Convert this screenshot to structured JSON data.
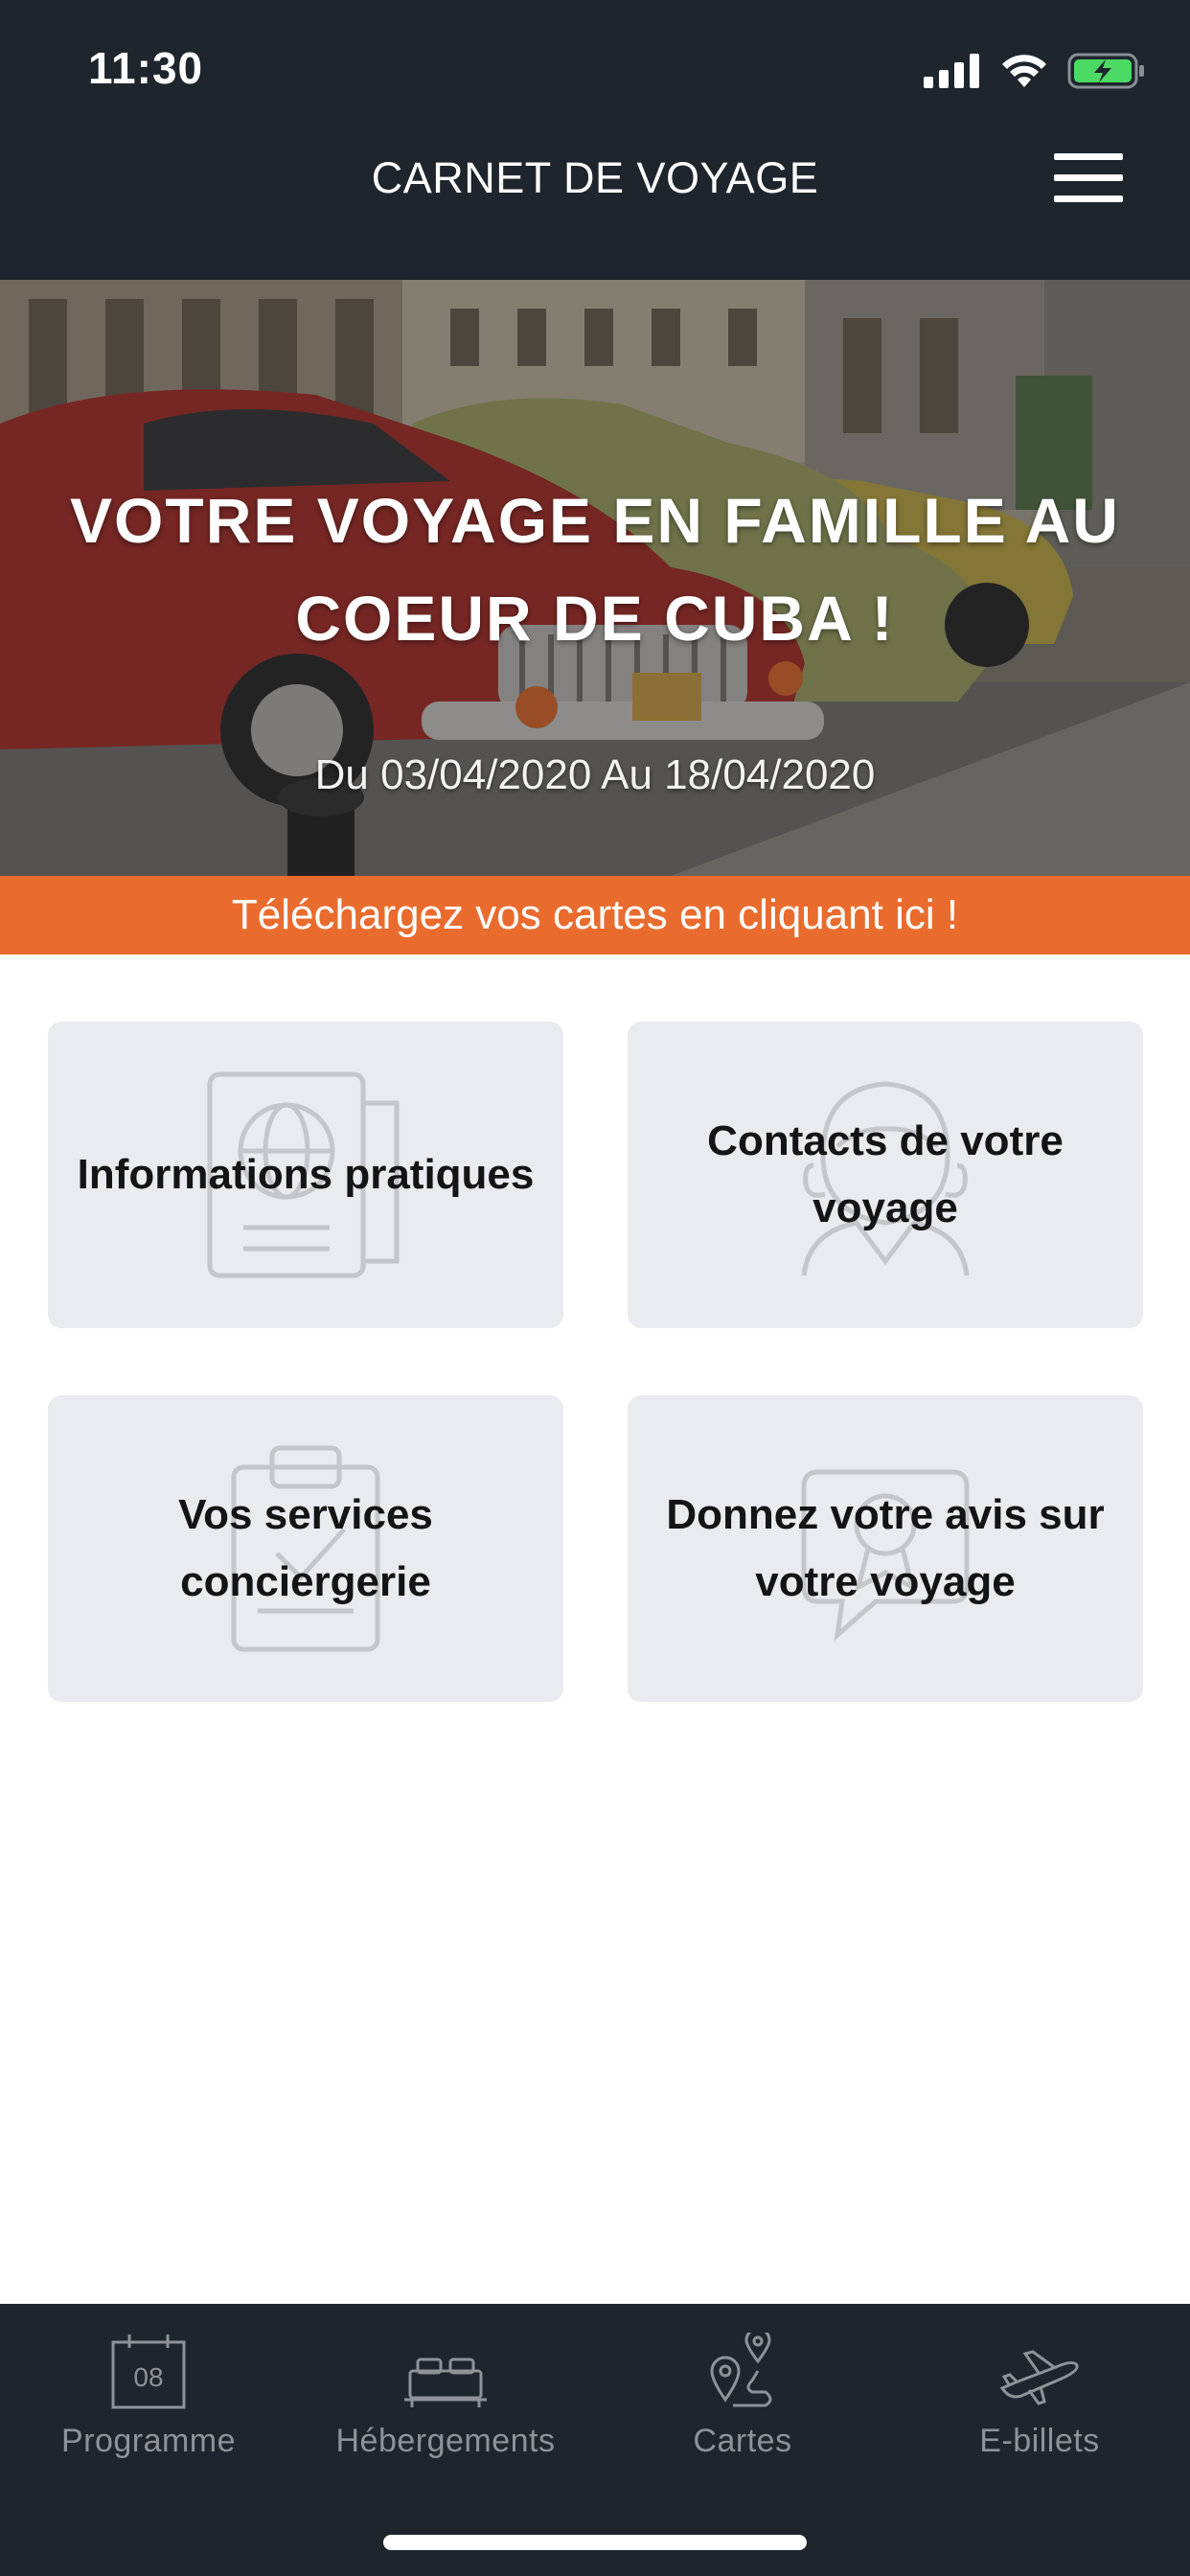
{
  "status_bar": {
    "time": "11:30",
    "icons": [
      "signal-icon",
      "wifi-icon",
      "battery-charging-icon"
    ]
  },
  "header": {
    "title": "CARNET DE VOYAGE",
    "menu_icon": "hamburger-menu-icon"
  },
  "hero": {
    "title": "VOTRE VOYAGE EN FAMILLE AU COEUR DE CUBA !",
    "dates": "Du 03/04/2020 Au 18/04/2020"
  },
  "banner": {
    "text": "Téléchargez vos cartes en cliquant ici !",
    "color": "#e96c2e"
  },
  "cards": [
    {
      "label": "Informations pratiques",
      "icon": "passport-icon"
    },
    {
      "label": "Contacts de votre voyage",
      "icon": "contact-person-icon"
    },
    {
      "label": "Vos services conciergerie",
      "icon": "clipboard-icon"
    },
    {
      "label": "Donnez votre avis sur votre voyage",
      "icon": "review-badge-icon"
    }
  ],
  "tabbar": {
    "tabs": [
      {
        "label": "Programme",
        "icon": "calendar-icon",
        "icon_text": "08"
      },
      {
        "label": "Hébergements",
        "icon": "bed-icon"
      },
      {
        "label": "Cartes",
        "icon": "map-pin-route-icon"
      },
      {
        "label": "E-billets",
        "icon": "airplane-icon"
      }
    ]
  },
  "colors": {
    "header_bg": "#1f252c",
    "accent": "#e96c2e",
    "card_bg": "#e9ebef",
    "tab_label": "#8e9398"
  }
}
